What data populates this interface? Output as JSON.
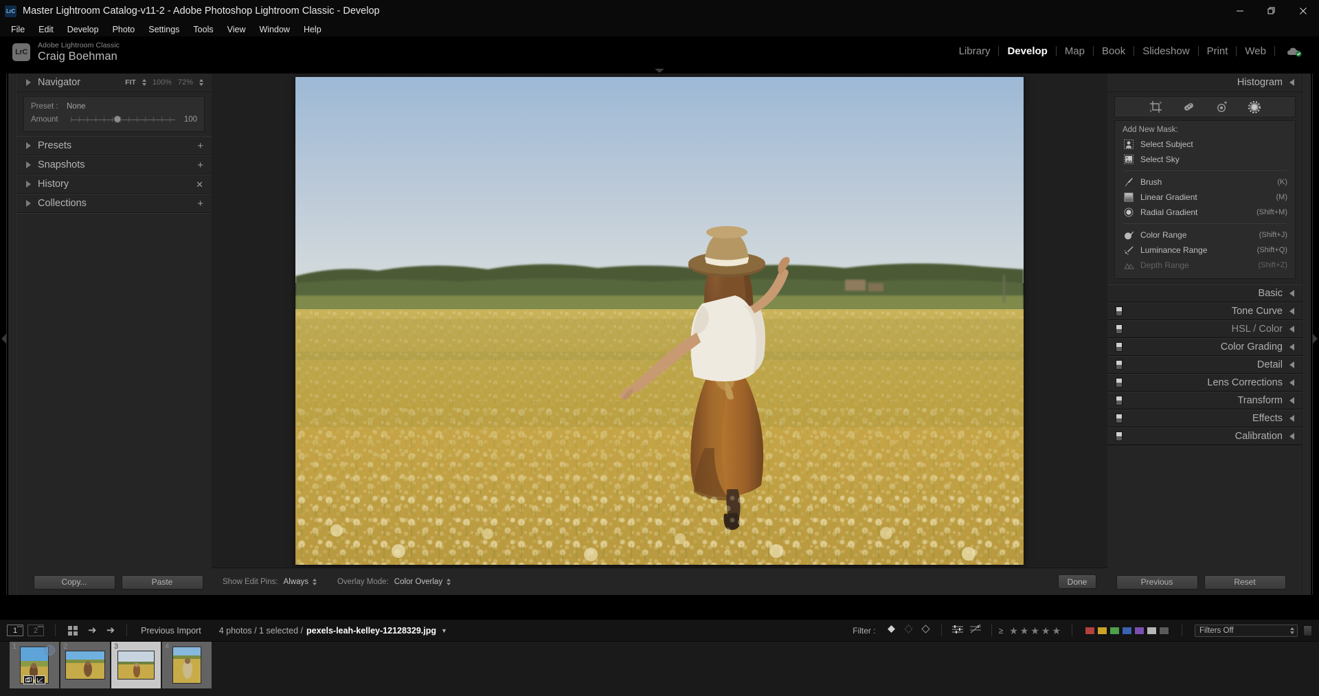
{
  "window": {
    "title": "Master Lightroom Catalog-v11-2 - Adobe Photoshop Lightroom Classic - Develop",
    "app_badge": "LrC",
    "controls": {
      "minimize": "minimize-icon",
      "maximize": "restore-icon",
      "close": "close-icon"
    }
  },
  "menu": {
    "items": [
      {
        "label": "File"
      },
      {
        "label": "Edit"
      },
      {
        "label": "Develop"
      },
      {
        "label": "Photo"
      },
      {
        "label": "Settings"
      },
      {
        "label": "Tools"
      },
      {
        "label": "View"
      },
      {
        "label": "Window"
      },
      {
        "label": "Help"
      }
    ]
  },
  "identity": {
    "badge": "LrC",
    "product": "Adobe Lightroom Classic",
    "user": "Craig Boehman"
  },
  "modules": {
    "items": [
      {
        "label": "Library",
        "active": false
      },
      {
        "label": "Develop",
        "active": true
      },
      {
        "label": "Map",
        "active": false
      },
      {
        "label": "Book",
        "active": false
      },
      {
        "label": "Slideshow",
        "active": false
      },
      {
        "label": "Print",
        "active": false
      },
      {
        "label": "Web",
        "active": false
      }
    ],
    "cloud_icon": "cloud-sync-icon"
  },
  "left_panel": {
    "navigator": {
      "title": "Navigator",
      "fit_label": "FIT",
      "zoom_100": "100%",
      "zoom_custom": "72%"
    },
    "preset_preview": {
      "preset_label": "Preset :",
      "preset_value": "None",
      "amount_label": "Amount",
      "amount_value": "100"
    },
    "sections": [
      {
        "title": "Presets",
        "action": "add-icon"
      },
      {
        "title": "Snapshots",
        "action": "add-icon"
      },
      {
        "title": "History",
        "action": "clear-icon"
      },
      {
        "title": "Collections",
        "action": "add-icon"
      }
    ],
    "buttons": {
      "copy": "Copy...",
      "paste": "Paste"
    }
  },
  "right_panel": {
    "histogram_title": "Histogram",
    "tools": [
      {
        "name": "crop-overlay-icon",
        "active": false
      },
      {
        "name": "spot-removal-icon",
        "active": false
      },
      {
        "name": "red-eye-icon",
        "active": false
      },
      {
        "name": "masking-icon",
        "active": true
      }
    ],
    "masking": {
      "label": "Add New Mask:",
      "items": [
        {
          "label": "Select Subject",
          "shortcut": "",
          "icon": "select-subject-icon",
          "disabled": false
        },
        {
          "label": "Select Sky",
          "shortcut": "",
          "icon": "select-sky-icon",
          "disabled": false
        },
        {
          "label": "Brush",
          "shortcut": "(K)",
          "icon": "brush-icon",
          "disabled": false
        },
        {
          "label": "Linear Gradient",
          "shortcut": "(M)",
          "icon": "linear-gradient-icon",
          "disabled": false
        },
        {
          "label": "Radial Gradient",
          "shortcut": "(Shift+M)",
          "icon": "radial-gradient-icon",
          "disabled": false
        },
        {
          "label": "Color Range",
          "shortcut": "(Shift+J)",
          "icon": "color-range-icon",
          "disabled": false
        },
        {
          "label": "Luminance Range",
          "shortcut": "(Shift+Q)",
          "icon": "luminance-range-icon",
          "disabled": false
        },
        {
          "label": "Depth Range",
          "shortcut": "(Shift+Z)",
          "icon": "depth-range-icon",
          "disabled": true
        }
      ]
    },
    "sections": [
      {
        "title": "Basic",
        "has_switch": false,
        "dim": false
      },
      {
        "title": "Tone Curve",
        "has_switch": true,
        "dim": false
      },
      {
        "title": "HSL / Color",
        "has_switch": true,
        "dim": true
      },
      {
        "title": "Color Grading",
        "has_switch": true,
        "dim": false
      },
      {
        "title": "Detail",
        "has_switch": true,
        "dim": false
      },
      {
        "title": "Lens Corrections",
        "has_switch": true,
        "dim": false
      },
      {
        "title": "Transform",
        "has_switch": true,
        "dim": false
      },
      {
        "title": "Effects",
        "has_switch": true,
        "dim": false
      },
      {
        "title": "Calibration",
        "has_switch": true,
        "dim": false
      }
    ],
    "buttons": {
      "previous": "Previous",
      "reset": "Reset"
    }
  },
  "toolbar": {
    "show_edit_pins_label": "Show Edit Pins:",
    "show_edit_pins_value": "Always",
    "overlay_mode_label": "Overlay Mode:",
    "overlay_mode_value": "Color Overlay",
    "done_label": "Done"
  },
  "filmstrip_bar": {
    "screen1": "1",
    "screen2": "2",
    "grid_icon": "grid-view-icon",
    "back_icon": "back-arrow-icon",
    "forward_icon": "forward-arrow-icon",
    "source": "Previous Import",
    "count_text": "4 photos / 1 selected /",
    "filename": "pexels-leah-kelley-12128329.jpg",
    "filter_label": "Filter :",
    "flag_icons": [
      "flag-pick-icon",
      "flag-unflagged-icon",
      "flag-reject-icon"
    ],
    "attribute_icons": [
      "master-photo-icon",
      "virtual-copy-icon"
    ],
    "rating_prefix": "≥",
    "star_count": 5,
    "color_swatches": [
      "#b4413d",
      "#c9a227",
      "#4f9f4a",
      "#3a62b0",
      "#7a4fb0",
      "#b6b6b6",
      "#5a5a5a"
    ],
    "filters_off": "Filters Off"
  },
  "filmstrip": {
    "thumbs": [
      {
        "number": "1",
        "selected": false,
        "has_badges": true,
        "has_circle": true
      },
      {
        "number": "2",
        "selected": false,
        "has_badges": false,
        "has_circle": false
      },
      {
        "number": "3",
        "selected": true,
        "has_badges": false,
        "has_circle": false
      },
      {
        "number": "4",
        "selected": false,
        "has_badges": false,
        "has_circle": false
      }
    ]
  },
  "photo": {
    "description": "Woman in white top and brown skirt with straw hat walking through a golden wildflower field under a blue sky with treeline on the horizon",
    "sky_top": "#a9c3dd",
    "sky_bottom": "#cfd9e0",
    "field_color": "#c6a845",
    "tree_color": "#44522f"
  },
  "colors": {
    "panel_bg": "#252525",
    "canvas_bg": "#1f1f1f",
    "chrome_bg": "#000000",
    "text_primary": "#b8b8b8",
    "text_active": "#ffffff",
    "accent_blue": "#3a62b0"
  }
}
